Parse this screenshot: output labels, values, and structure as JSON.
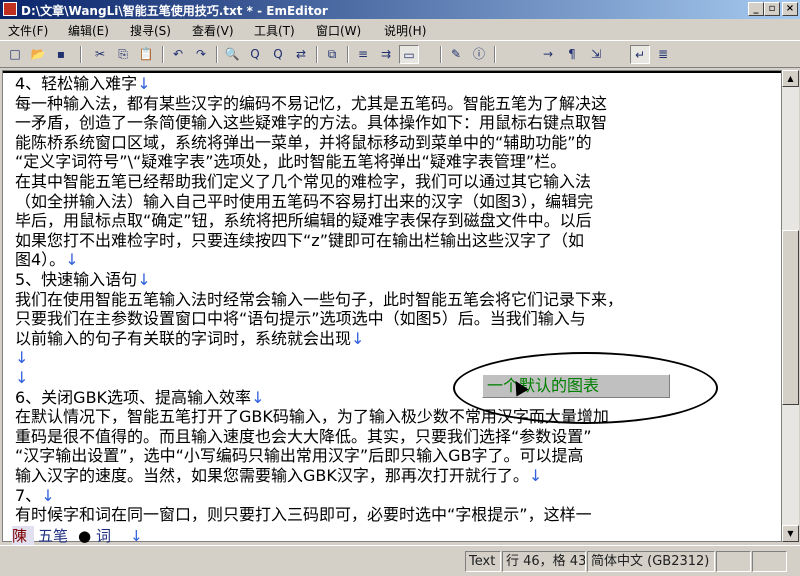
{
  "window": {
    "title": "D:\\文章\\WangLi\\智能五笔使用技巧.txt * - EmEditor",
    "min_label": "_",
    "max_label": "▫",
    "close_label": "×"
  },
  "menu": [
    "文件(F)",
    "编辑(E)",
    "搜寻(S)",
    "查看(V)",
    "工具(T)",
    "窗口(W)",
    "说明(H)"
  ],
  "toolbar": {
    "icons": [
      "new-file-icon",
      "open-folder-icon",
      "save-icon",
      "cut-icon",
      "copy-icon",
      "paste-icon",
      "undo-icon",
      "redo-icon",
      "find-icon",
      "find-prev-icon",
      "find-next-icon",
      "replace-icon",
      "highlight-icon",
      "wrap-none-icon",
      "wrap-window-icon",
      "wrap-page-icon",
      "properties-icon",
      "info-icon",
      "tab-marks-icon",
      "eol-marks-icon",
      "eof-marks-icon",
      "return-marks-icon",
      "paragraph-icon"
    ],
    "glyphs": [
      "□",
      "📂",
      "▪",
      "✂",
      "⎘",
      "📋",
      "↶",
      "↷",
      "🔍",
      "Q",
      "Q",
      "⇄",
      "⧉",
      "≡",
      "⇉",
      "▭",
      "✎",
      "ⓘ",
      "→",
      "¶",
      "⇲",
      "↵",
      "≣"
    ]
  },
  "document": {
    "lines": [
      {
        "text": "4、轻松输入难字",
        "mark": "↓"
      },
      {
        "text": "每一种输入法，都有某些汉字的编码不易记忆，尤其是五笔码。智能五笔为了解决这",
        "mark": ""
      },
      {
        "text": "一矛盾，创造了一条简便输入这些疑难字的方法。具体操作如下：用鼠标右键点取智",
        "mark": ""
      },
      {
        "text": "能陈桥系统窗口区域，系统将弹出一菜单，并将鼠标移动到菜单中的“辅助功能”的",
        "mark": ""
      },
      {
        "text": "“定义字词符号”\\“疑难字表”选项处，此时智能五笔将弹出“疑难字表管理”栏。",
        "mark": ""
      },
      {
        "text": "在其中智能五笔已经帮助我们定义了几个常见的难检字，我们可以通过其它输入法",
        "mark": ""
      },
      {
        "text": "（如全拼输入法）输入自己平时使用五笔码不容易打出来的汉字（如图3），编辑完",
        "mark": ""
      },
      {
        "text": "毕后，用鼠标点取“确定”钮，系统将把所编辑的疑难字表保存到磁盘文件中。以后",
        "mark": ""
      },
      {
        "text": "如果您打不出难检字时，只要连续按四下“z”键即可在输出栏输出这些汉字了（如",
        "mark": ""
      },
      {
        "text": "图4）。",
        "mark": "↓"
      },
      {
        "text": "5、快速输入语句",
        "mark": "↓"
      },
      {
        "text": "我们在使用智能五笔输入法时经常会输入一些句子，此时智能五笔会将它们记录下来，",
        "mark": ""
      },
      {
        "text": "只要我们在主参数设置窗口中将“语句提示”选项选中（如图5）后。当我们输入与",
        "mark": ""
      },
      {
        "text": "以前输入的句子有关联的字词时，系统就会出现",
        "mark": "↓"
      },
      {
        "text": "",
        "mark": "↓"
      },
      {
        "text": "",
        "mark": "↓"
      },
      {
        "text": "6、关闭GBK选项、提高输入效率",
        "mark": "↓"
      },
      {
        "text": "在默认情况下，智能五笔打开了GBK码输入，为了输入极少数不常用汉字而大量增加",
        "mark": ""
      },
      {
        "text": "重码是很不值得的。而且输入速度也会大大降低。其实，只要我们选择“参数设置”",
        "mark": ""
      },
      {
        "text": "“汉字输出设置”，选中“小写编码只输出常用汉字”后即只输入GB字了。可以提高",
        "mark": ""
      },
      {
        "text": "输入汉字的速度。当然，如果您需要输入GBK汉字，那再次打开就行了。",
        "mark": "↓"
      },
      {
        "text": "7、",
        "mark": "↓"
      },
      {
        "text": "有时候字和词在同一窗口，则只要打入三码即可，必要时选中“字根提示”，这样一",
        "mark": ""
      }
    ]
  },
  "annotation": {
    "label": "一个默认的图表"
  },
  "ime": {
    "mode": "陳",
    "name": "五笔",
    "dot": "●",
    "punct": "词",
    "extra": "↓"
  },
  "status": {
    "mode": "Text",
    "position": "行 46，格 43",
    "encoding": "简体中文 (GB2312)",
    "p4": "",
    "p5": ""
  }
}
